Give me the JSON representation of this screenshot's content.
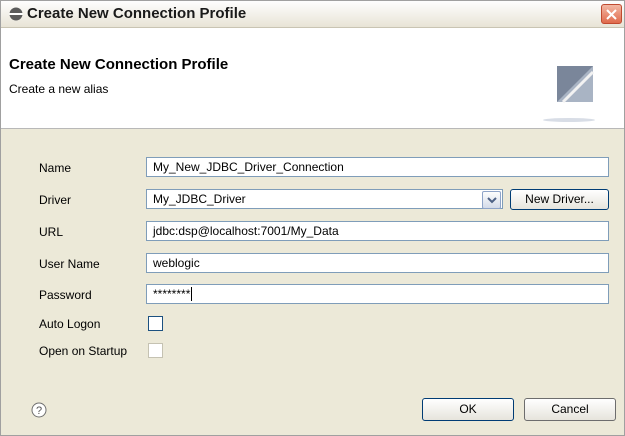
{
  "window": {
    "title": "Create New Connection Profile"
  },
  "header": {
    "title": "Create New Connection Profile",
    "subtitle": "Create a new alias"
  },
  "form": {
    "name_label": "Name",
    "name_value": "My_New_JDBC_Driver_Connection",
    "driver_label": "Driver",
    "driver_value": "My_JDBC_Driver",
    "new_driver_button": "New Driver...",
    "url_label": "URL",
    "url_value": "jdbc:dsp@localhost:7001/My_Data",
    "user_label": "User Name",
    "user_value": "weblogic",
    "password_label": "Password",
    "password_value": "********",
    "auto_logon_label": "Auto Logon",
    "auto_logon_checked": false,
    "open_startup_label": "Open on Startup",
    "open_startup_checked": false
  },
  "footer": {
    "ok_label": "OK",
    "cancel_label": "Cancel"
  },
  "icons": [
    "connection-icon",
    "close-icon",
    "wizard-banner-icon",
    "chevron-down-icon",
    "help-icon"
  ]
}
